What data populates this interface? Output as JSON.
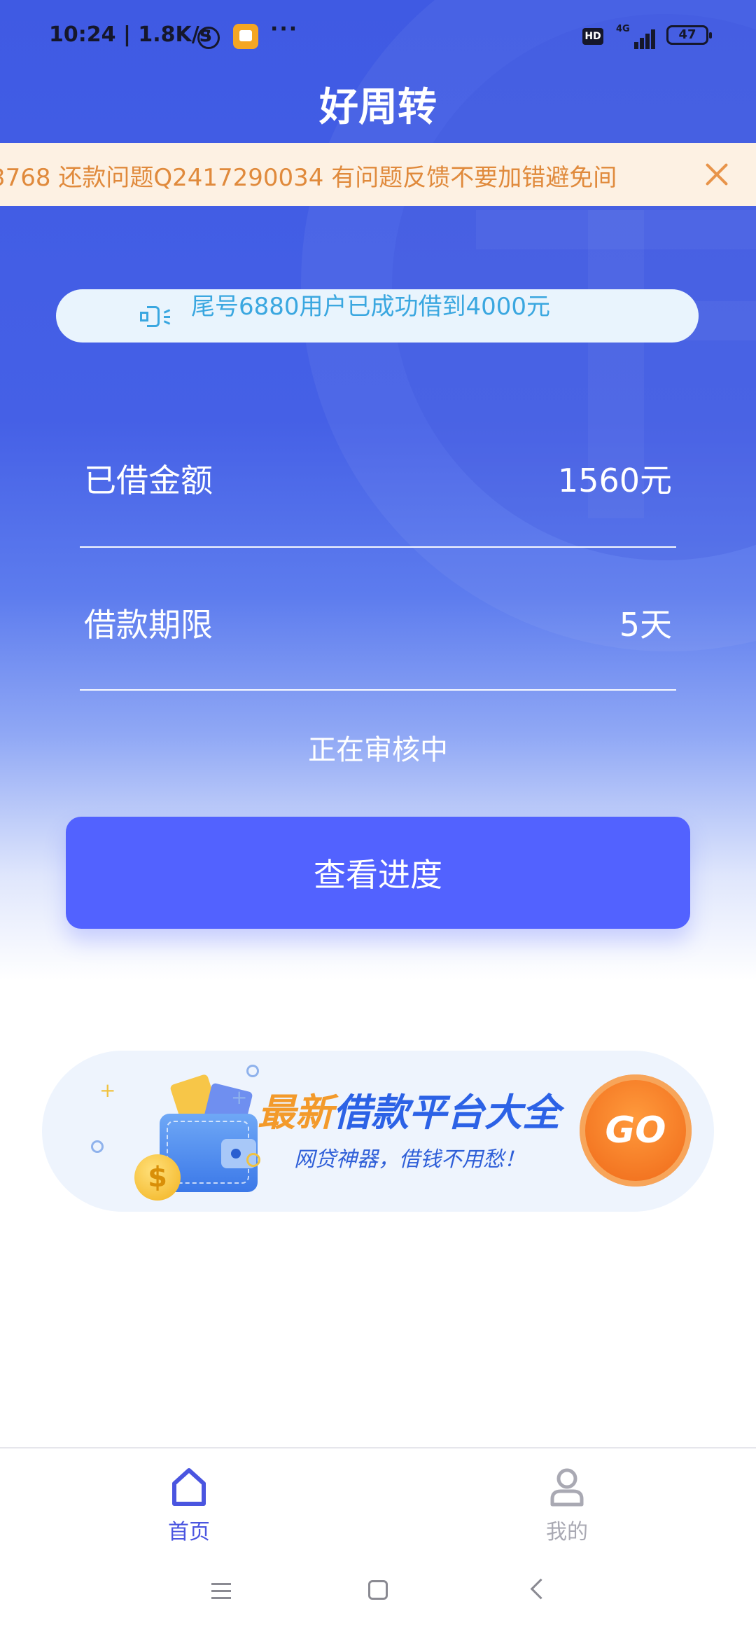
{
  "status_bar": {
    "time_speed": "10:24 | 1.8K/s",
    "more": "···",
    "hd": "HD",
    "network": "4G",
    "battery": "47"
  },
  "app": {
    "title": "好周转"
  },
  "notice": {
    "text": "3768 还款问题Q2417290034 有问题反馈不要加错避免间"
  },
  "broadcast": {
    "text": "尾号6880用户已成功借到4000元"
  },
  "loan": {
    "amount_label": "已借金额",
    "amount_value": "1560元",
    "term_label": "借款期限",
    "term_value": "5天",
    "status": "正在审核中",
    "progress_button": "查看进度"
  },
  "promo": {
    "title_highlight": "最新",
    "title_rest": "借款平台大全",
    "subtitle": "网贷神器，借钱不用愁！",
    "go_label": "GO",
    "coin_symbol": "$"
  },
  "tabs": [
    {
      "label": "首页",
      "active": true
    },
    {
      "label": "我的",
      "active": false
    }
  ],
  "colors": {
    "primary": "#5262ff",
    "header_blue": "#3f5ae3",
    "notice_text": "#e08a3c",
    "notice_bg": "#fdf1e3",
    "broadcast_text": "#3aa7e0",
    "promo_orange": "#f39a2b",
    "tab_active": "#4a55e0",
    "tab_inactive": "#a9a9b3"
  },
  "icons": {
    "alarm": "alarm-clock-icon",
    "notification": "notification-app-icon",
    "close": "close-icon",
    "speaker": "speaker-icon",
    "home": "home-icon",
    "profile": "profile-icon"
  }
}
